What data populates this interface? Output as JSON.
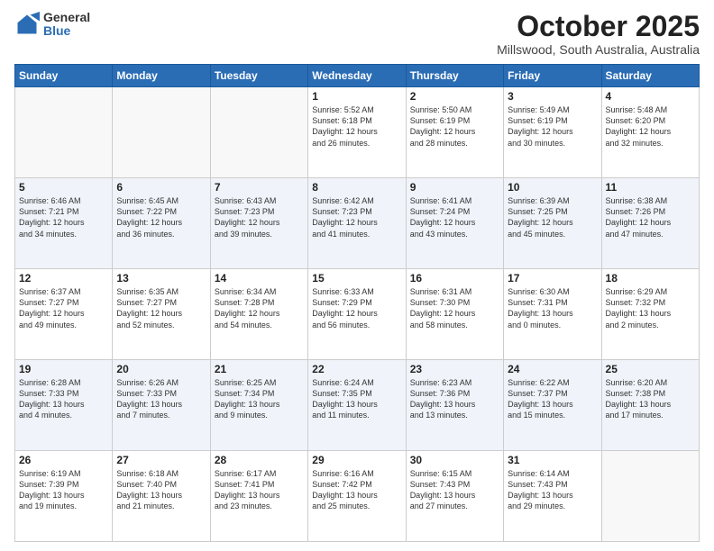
{
  "header": {
    "logo_general": "General",
    "logo_blue": "Blue",
    "month_title": "October 2025",
    "location": "Millswood, South Australia, Australia"
  },
  "days_of_week": [
    "Sunday",
    "Monday",
    "Tuesday",
    "Wednesday",
    "Thursday",
    "Friday",
    "Saturday"
  ],
  "weeks": [
    [
      {
        "day": "",
        "content": ""
      },
      {
        "day": "",
        "content": ""
      },
      {
        "day": "",
        "content": ""
      },
      {
        "day": "1",
        "content": "Sunrise: 5:52 AM\nSunset: 6:18 PM\nDaylight: 12 hours\nand 26 minutes."
      },
      {
        "day": "2",
        "content": "Sunrise: 5:50 AM\nSunset: 6:19 PM\nDaylight: 12 hours\nand 28 minutes."
      },
      {
        "day": "3",
        "content": "Sunrise: 5:49 AM\nSunset: 6:19 PM\nDaylight: 12 hours\nand 30 minutes."
      },
      {
        "day": "4",
        "content": "Sunrise: 5:48 AM\nSunset: 6:20 PM\nDaylight: 12 hours\nand 32 minutes."
      }
    ],
    [
      {
        "day": "5",
        "content": "Sunrise: 6:46 AM\nSunset: 7:21 PM\nDaylight: 12 hours\nand 34 minutes."
      },
      {
        "day": "6",
        "content": "Sunrise: 6:45 AM\nSunset: 7:22 PM\nDaylight: 12 hours\nand 36 minutes."
      },
      {
        "day": "7",
        "content": "Sunrise: 6:43 AM\nSunset: 7:23 PM\nDaylight: 12 hours\nand 39 minutes."
      },
      {
        "day": "8",
        "content": "Sunrise: 6:42 AM\nSunset: 7:23 PM\nDaylight: 12 hours\nand 41 minutes."
      },
      {
        "day": "9",
        "content": "Sunrise: 6:41 AM\nSunset: 7:24 PM\nDaylight: 12 hours\nand 43 minutes."
      },
      {
        "day": "10",
        "content": "Sunrise: 6:39 AM\nSunset: 7:25 PM\nDaylight: 12 hours\nand 45 minutes."
      },
      {
        "day": "11",
        "content": "Sunrise: 6:38 AM\nSunset: 7:26 PM\nDaylight: 12 hours\nand 47 minutes."
      }
    ],
    [
      {
        "day": "12",
        "content": "Sunrise: 6:37 AM\nSunset: 7:27 PM\nDaylight: 12 hours\nand 49 minutes."
      },
      {
        "day": "13",
        "content": "Sunrise: 6:35 AM\nSunset: 7:27 PM\nDaylight: 12 hours\nand 52 minutes."
      },
      {
        "day": "14",
        "content": "Sunrise: 6:34 AM\nSunset: 7:28 PM\nDaylight: 12 hours\nand 54 minutes."
      },
      {
        "day": "15",
        "content": "Sunrise: 6:33 AM\nSunset: 7:29 PM\nDaylight: 12 hours\nand 56 minutes."
      },
      {
        "day": "16",
        "content": "Sunrise: 6:31 AM\nSunset: 7:30 PM\nDaylight: 12 hours\nand 58 minutes."
      },
      {
        "day": "17",
        "content": "Sunrise: 6:30 AM\nSunset: 7:31 PM\nDaylight: 13 hours\nand 0 minutes."
      },
      {
        "day": "18",
        "content": "Sunrise: 6:29 AM\nSunset: 7:32 PM\nDaylight: 13 hours\nand 2 minutes."
      }
    ],
    [
      {
        "day": "19",
        "content": "Sunrise: 6:28 AM\nSunset: 7:33 PM\nDaylight: 13 hours\nand 4 minutes."
      },
      {
        "day": "20",
        "content": "Sunrise: 6:26 AM\nSunset: 7:33 PM\nDaylight: 13 hours\nand 7 minutes."
      },
      {
        "day": "21",
        "content": "Sunrise: 6:25 AM\nSunset: 7:34 PM\nDaylight: 13 hours\nand 9 minutes."
      },
      {
        "day": "22",
        "content": "Sunrise: 6:24 AM\nSunset: 7:35 PM\nDaylight: 13 hours\nand 11 minutes."
      },
      {
        "day": "23",
        "content": "Sunrise: 6:23 AM\nSunset: 7:36 PM\nDaylight: 13 hours\nand 13 minutes."
      },
      {
        "day": "24",
        "content": "Sunrise: 6:22 AM\nSunset: 7:37 PM\nDaylight: 13 hours\nand 15 minutes."
      },
      {
        "day": "25",
        "content": "Sunrise: 6:20 AM\nSunset: 7:38 PM\nDaylight: 13 hours\nand 17 minutes."
      }
    ],
    [
      {
        "day": "26",
        "content": "Sunrise: 6:19 AM\nSunset: 7:39 PM\nDaylight: 13 hours\nand 19 minutes."
      },
      {
        "day": "27",
        "content": "Sunrise: 6:18 AM\nSunset: 7:40 PM\nDaylight: 13 hours\nand 21 minutes."
      },
      {
        "day": "28",
        "content": "Sunrise: 6:17 AM\nSunset: 7:41 PM\nDaylight: 13 hours\nand 23 minutes."
      },
      {
        "day": "29",
        "content": "Sunrise: 6:16 AM\nSunset: 7:42 PM\nDaylight: 13 hours\nand 25 minutes."
      },
      {
        "day": "30",
        "content": "Sunrise: 6:15 AM\nSunset: 7:43 PM\nDaylight: 13 hours\nand 27 minutes."
      },
      {
        "day": "31",
        "content": "Sunrise: 6:14 AM\nSunset: 7:43 PM\nDaylight: 13 hours\nand 29 minutes."
      },
      {
        "day": "",
        "content": ""
      }
    ]
  ]
}
